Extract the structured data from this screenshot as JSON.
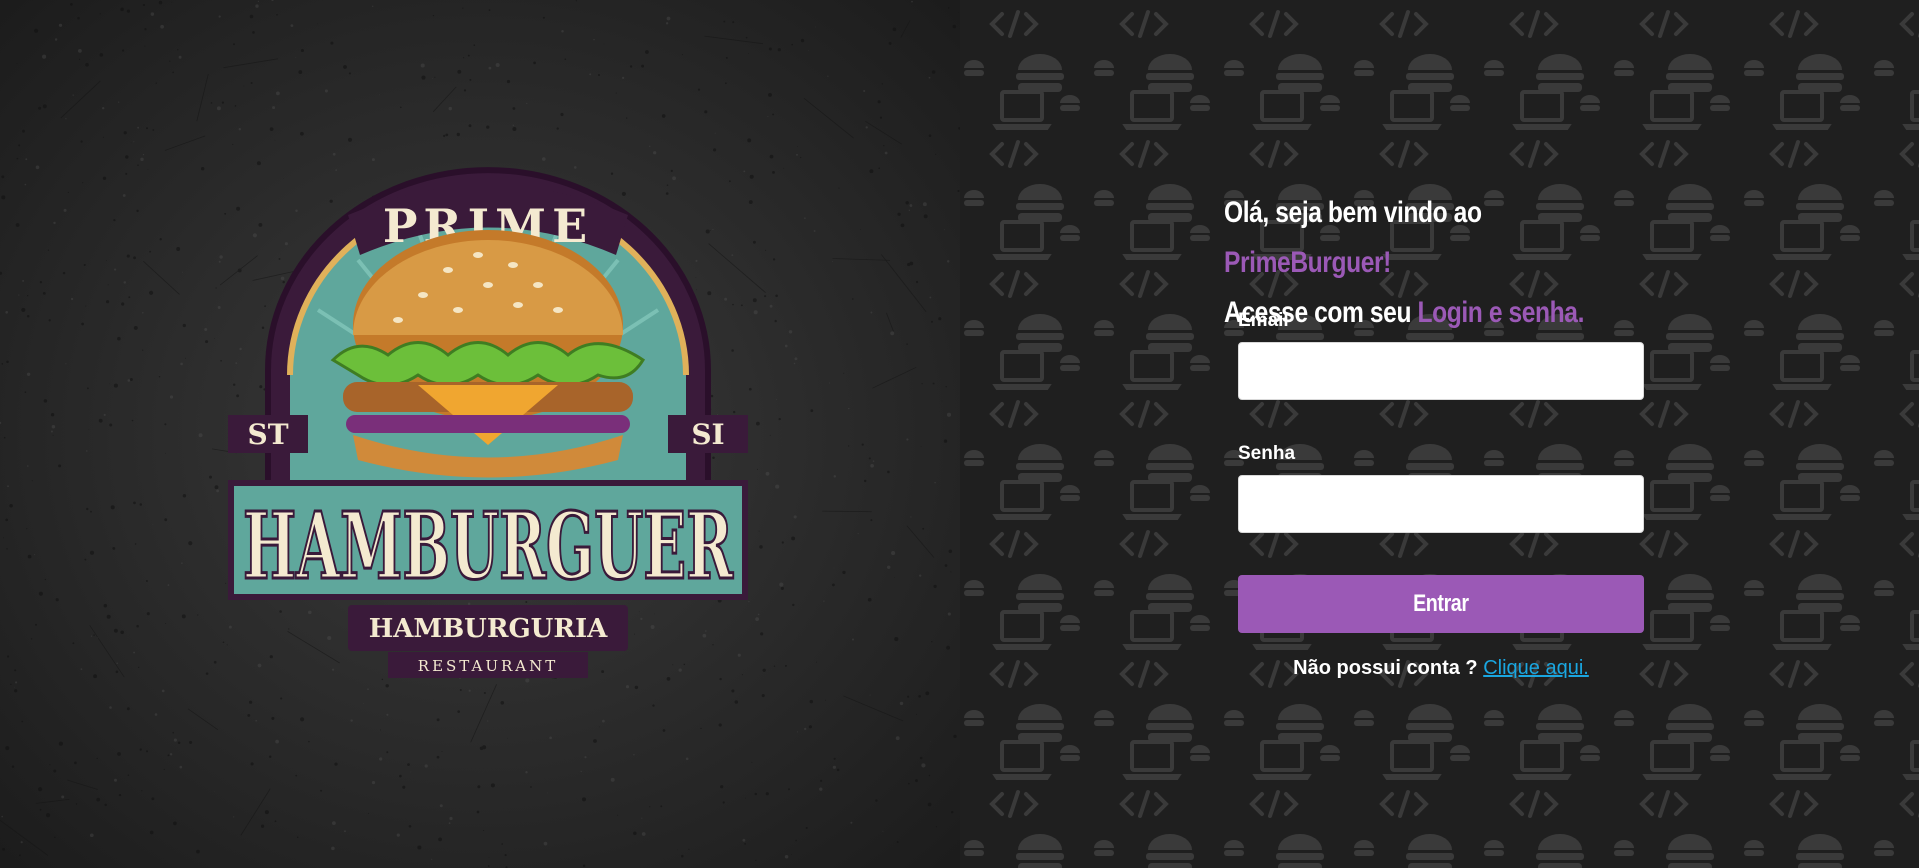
{
  "logo": {
    "top_word": "PRIME",
    "main_word": "HAMBURGUER",
    "sub_word": "HAMBURGURIA",
    "small_word": "RESTAURANT",
    "side_left": "ST",
    "side_right": "SI"
  },
  "login": {
    "greeting_line1_prefix": "Olá, seja bem vindo ao ",
    "greeting_line1_brand": "PrimeBurguer!",
    "greeting_line2_prefix": "Acesse com seu ",
    "greeting_line2_accent": "Login e senha.",
    "email_label": "Email",
    "email_value": "",
    "password_label": "Senha",
    "password_value": "",
    "submit_label": "Entrar",
    "signup_text": "Não possui conta ? ",
    "signup_link": "Clique aqui."
  },
  "colors": {
    "accent": "#9b59b6",
    "link": "#1aa6e0",
    "left_background": "#2b2b2b",
    "right_background": "#1f1f1f"
  },
  "icons": [
    "burger-icon",
    "code-icon",
    "laptop-icon"
  ]
}
